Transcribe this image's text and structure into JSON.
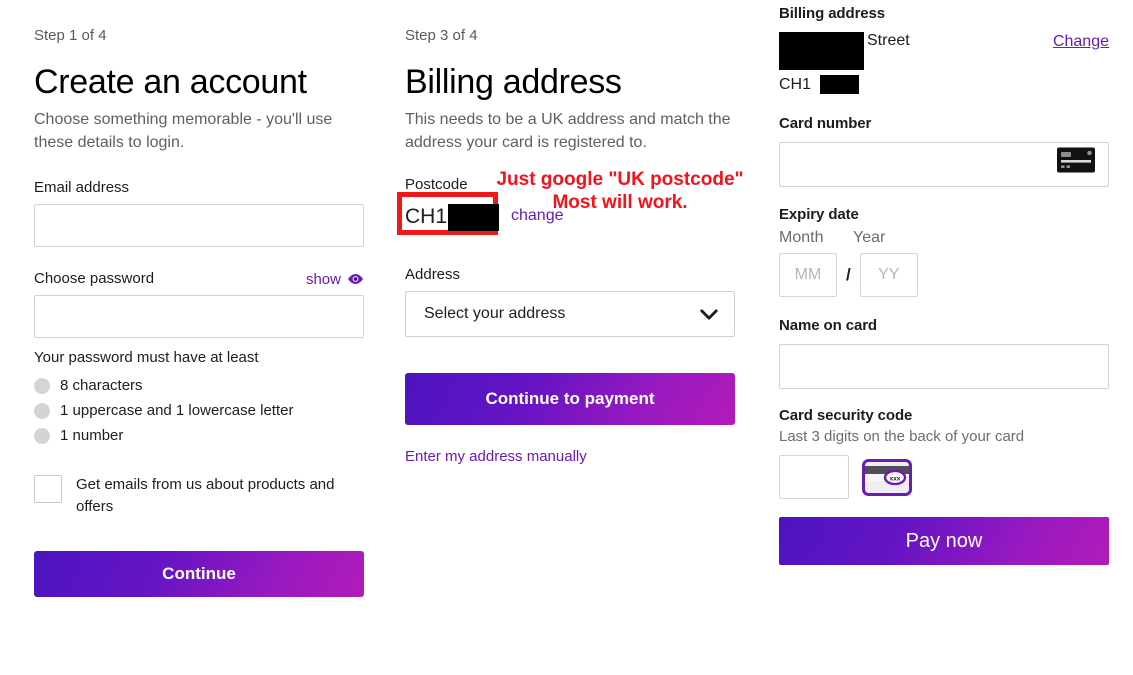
{
  "account": {
    "step": "Step 1 of 4",
    "title": "Create an account",
    "subtitle": "Choose something memorable - you'll use these details to login.",
    "email_label": "Email address",
    "email_value": "",
    "password_label": "Choose password",
    "password_value": "",
    "show_label": "show",
    "show_icon": "eye-icon",
    "requirements_title": "Your password must have at least",
    "requirements": [
      "8 characters",
      "1 uppercase and 1 lowercase letter",
      "1 number"
    ],
    "consent_label": "Get emails from us about products and offers",
    "consent_checked": false,
    "continue_label": "Continue"
  },
  "billing": {
    "step": "Step 3 of 4",
    "title": "Billing address",
    "subtitle": "This needs to be a UK address and match the address your card is registered to.",
    "postcode_label": "Postcode",
    "postcode_value": "CH1",
    "postcode_redacted": true,
    "change_label": "change",
    "address_label": "Address",
    "address_selected": "Select your address",
    "dropdown_icon": "chevron-down-icon",
    "continue_label": "Continue to payment",
    "manual_link": "Enter my address manually",
    "annotation": "Just google \"UK postcode\"\nMost will work.",
    "annotation_color": "#f5131b",
    "highlight_color": "#f01919"
  },
  "payment": {
    "billing_address_heading": "Billing address",
    "street_text": "Street",
    "postcode_text": "CH1",
    "change_label": "Change",
    "card_number_label": "Card number",
    "card_number_value": "",
    "card_icon": "credit-card-icon",
    "expiry_heading": "Expiry date",
    "month_label": "Month",
    "year_label": "Year",
    "month_placeholder": "MM",
    "year_placeholder": "YY",
    "separator": "/",
    "name_on_card_label": "Name on card",
    "name_on_card_value": "",
    "security_code_label": "Card security code",
    "security_code_hint": "Last 3 digits on the back of your card",
    "security_code_value": "",
    "cvv_icon": "cvv-card-icon",
    "cvv_icon_text": "xxx",
    "pay_label": "Pay now"
  },
  "theme": {
    "accent": "#6a1bb3",
    "gradient_start": "#4b15bd",
    "gradient_end": "#b21bb8",
    "annotation_red": "#f5131b"
  }
}
